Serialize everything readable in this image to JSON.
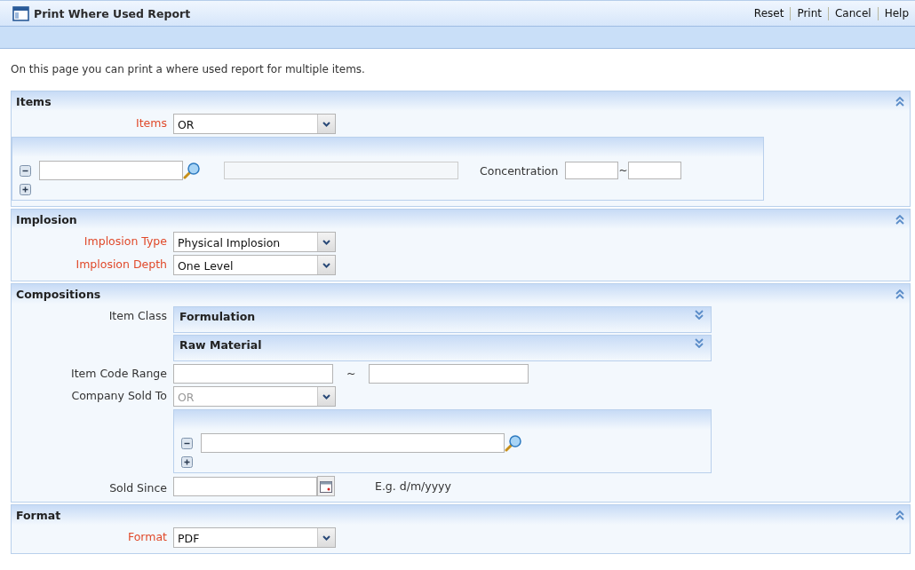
{
  "window": {
    "title": "Print Where Used Report"
  },
  "actions": [
    "Reset",
    "Print",
    "Cancel",
    "Help"
  ],
  "intro": "On this page you can print a where used report for multiple items.",
  "sections": [
    {
      "title": "Items",
      "expanded": true,
      "fields": [
        {
          "kind": "select",
          "label": "Items",
          "required": true,
          "value": "OR",
          "disabled": false
        },
        {
          "kind": "item_list",
          "concentration_label": "Concentration",
          "separator": "~"
        }
      ]
    },
    {
      "title": "Implosion",
      "expanded": true,
      "fields": [
        {
          "kind": "select",
          "label": "Implosion Type",
          "required": true,
          "value": "Physical Implosion",
          "disabled": false
        },
        {
          "kind": "select",
          "label": "Implosion Depth",
          "required": true,
          "value": "One Level",
          "disabled": false
        }
      ]
    },
    {
      "title": "Compositions",
      "expanded": true,
      "fields": [
        {
          "kind": "subpanels",
          "label": "Item Class",
          "required": false,
          "panels": [
            {
              "title": "Formulation",
              "expanded": false
            },
            {
              "title": "Raw Material",
              "expanded": false
            }
          ]
        },
        {
          "kind": "range",
          "label": "Item Code Range",
          "required": false,
          "separator": "~"
        },
        {
          "kind": "select",
          "label": "Company Sold To",
          "required": false,
          "value": "OR",
          "disabled": true
        },
        {
          "kind": "lookup_list"
        },
        {
          "kind": "date",
          "label": "Sold Since",
          "required": false,
          "hint": "E.g. d/m/yyyy"
        }
      ]
    },
    {
      "title": "Format",
      "expanded": true,
      "fields": [
        {
          "kind": "select",
          "label": "Format",
          "required": true,
          "value": "PDF",
          "disabled": false
        }
      ]
    }
  ]
}
